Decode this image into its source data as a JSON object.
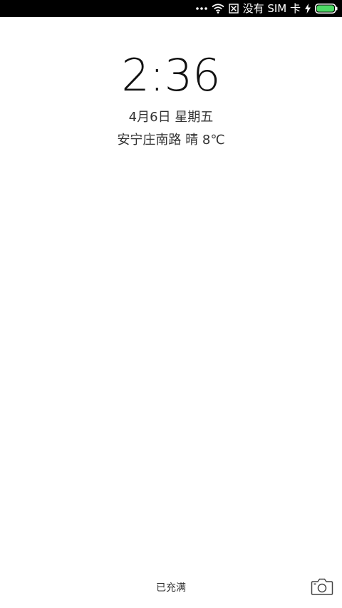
{
  "status_bar": {
    "overflow_icon": "more-dots-icon",
    "wifi_icon": "wifi-icon",
    "sim_status_icon": "no-sim-icon",
    "sim_text": "没有 SIM 卡",
    "charging_icon": "charging-bolt-icon",
    "battery_icon": "battery-icon",
    "battery_level": 1.0,
    "battery_color": "#4cd964"
  },
  "lockscreen": {
    "time": "2:36",
    "date": "4月6日 星期五",
    "weather": "安宁庄南路 晴 8℃",
    "charging_status": "已充满",
    "camera_icon": "camera-icon"
  }
}
